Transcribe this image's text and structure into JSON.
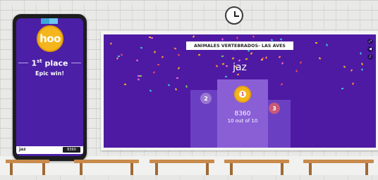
{
  "phone": {
    "logo": "hoo",
    "place_number": "1",
    "place_suffix": "st",
    "place_word": "place",
    "message": "Epic win!",
    "player_name": "jaz",
    "player_score": "8360"
  },
  "screen": {
    "title": "ANIMALES VERTEBRADOS- LAS AVES",
    "player_name": "jaz",
    "podium": {
      "first": {
        "rank": "1",
        "score": "8360",
        "result": "10 out of 10"
      },
      "second": {
        "rank": "2"
      },
      "third": {
        "rank": "3"
      }
    },
    "controls": [
      "fullscreen-icon",
      "sound-icon",
      "music-icon"
    ]
  },
  "colors": {
    "screen_bg": "#4e1aa3",
    "gold": "#f5b51c",
    "silver": "#9a78cf",
    "bronze": "#c85a76",
    "desk": "#c98a4b"
  }
}
